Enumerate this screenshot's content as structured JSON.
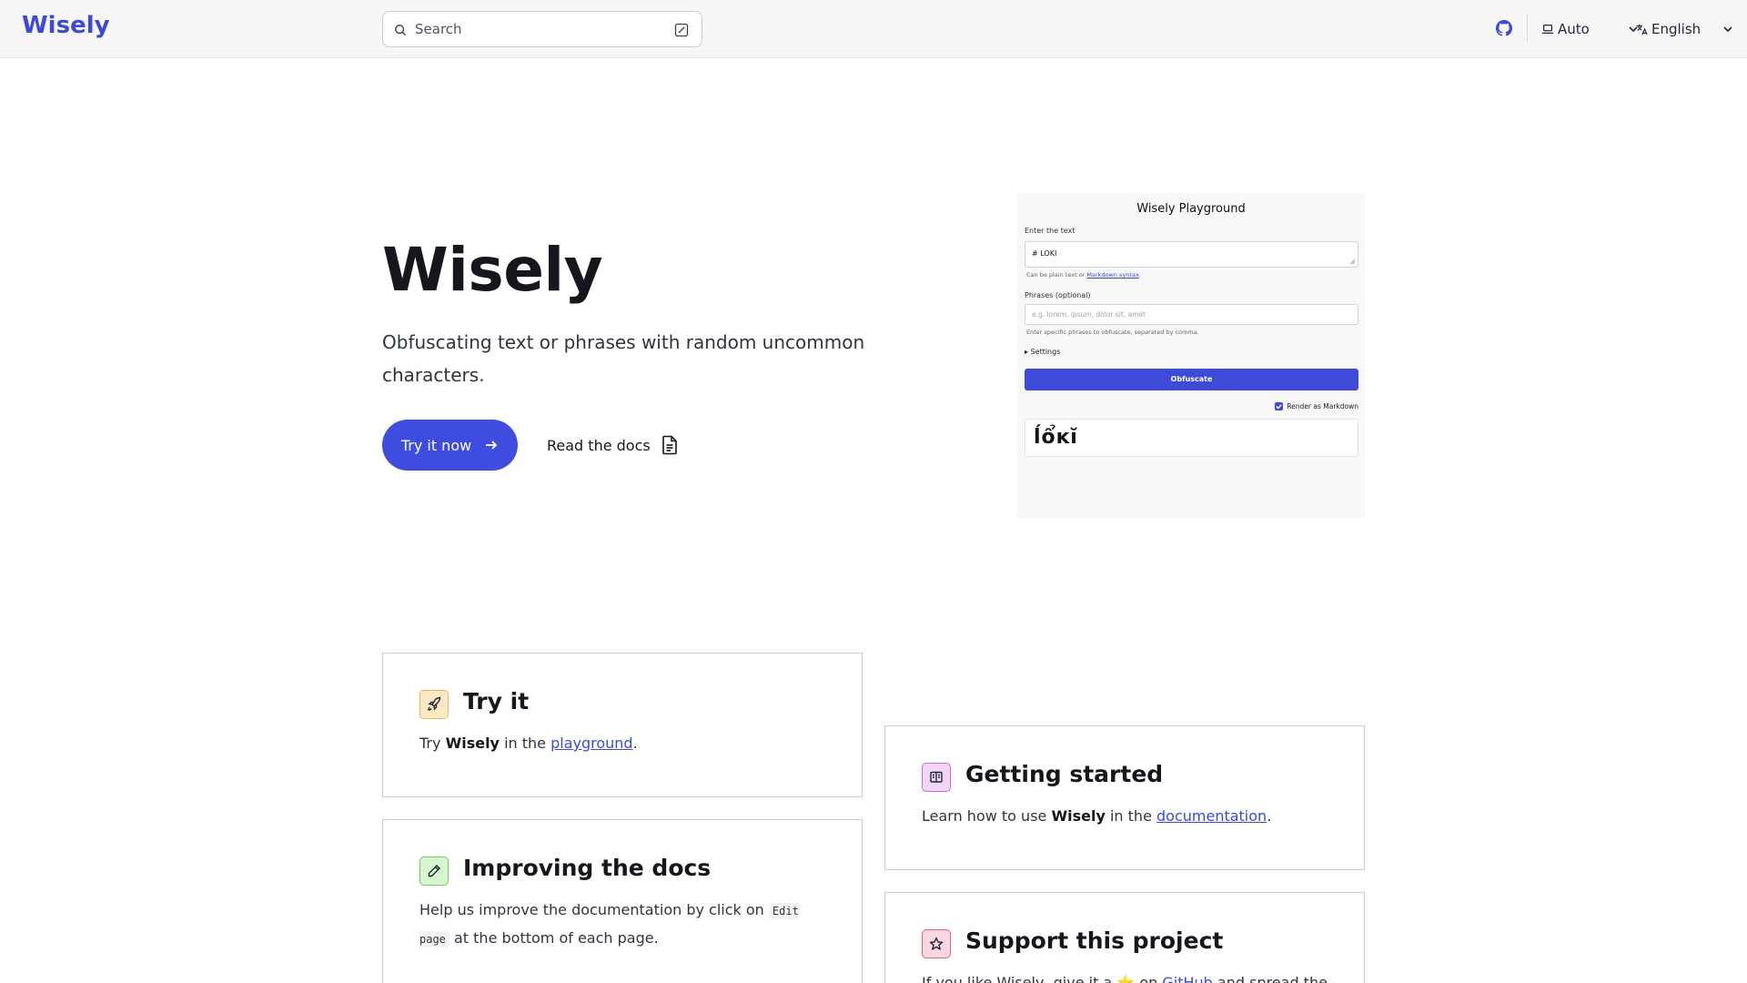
{
  "header": {
    "logo": "Wisely",
    "search_placeholder": "Search",
    "theme_label": "Auto",
    "language_label": "English"
  },
  "hero": {
    "title": "Wisely",
    "subtitle": "Obfuscating text or phrases with random uncommon characters.",
    "try_button": "Try it now",
    "docs_button": "Read the docs"
  },
  "playground": {
    "title": "Wisely Playground",
    "text_label": "Enter the text",
    "text_value": "# LOKI",
    "text_hint_prefix": "Can be plain text or ",
    "text_hint_link": "Markdown syntax",
    "text_hint_suffix": ".",
    "phrases_label": "Phrases (optional)",
    "phrases_placeholder": "e.g. lorem, ipsum, dolor sit, amet",
    "phrases_hint": "Enter specific phrases to obfuscate, separated by comma.",
    "settings_label": "Settings",
    "obfuscate_button": "Obfuscate",
    "render_markdown_label": "Render as Markdown",
    "render_markdown_checked": true,
    "output": "ĺổĸĭ"
  },
  "cards": {
    "try_it": {
      "title": "Try it",
      "text_1": "Try ",
      "text_bold": "Wisely",
      "text_2": " in the ",
      "link": "playground",
      "text_3": "."
    },
    "getting_started": {
      "title": "Getting started",
      "text_1": "Learn how to use ",
      "text_bold": "Wisely",
      "text_2": " in the ",
      "link": "documentation",
      "text_3": "."
    },
    "improving_docs": {
      "title": "Improving the docs",
      "text_1": "Help us improve the documentation by click on ",
      "code": "Edit page",
      "text_2": " at the bottom of each page."
    },
    "support": {
      "title": "Support this project",
      "text_1": "If you like Wisely, give it a ",
      "star": "⭐",
      "text_2": " on ",
      "link": "GitHub",
      "text_3": " and spread the"
    }
  },
  "colors": {
    "brand": "#3c4ad6",
    "primary_button": "#3e4de0",
    "try_icon_bg": "#fde9c4",
    "docs_icon_bg": "#f3d6f5",
    "edit_icon_bg": "#d7f5cf",
    "star_icon_bg": "#fcd7e0"
  },
  "icons": {
    "search": "search-icon",
    "keyboard_shortcut": "keyboard-shortcut-icon",
    "github": "github-icon",
    "theme": "laptop-icon",
    "language": "translate-icon",
    "arrow": "arrow-right-icon",
    "document": "document-icon",
    "rocket": "rocket-icon",
    "book": "book-icon",
    "pencil": "pencil-icon",
    "star": "star-icon"
  }
}
